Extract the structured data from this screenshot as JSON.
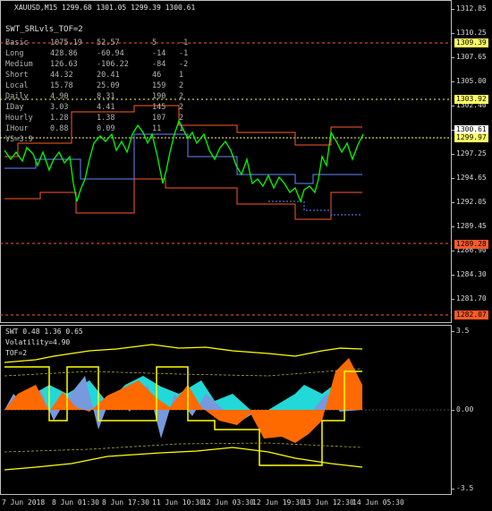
{
  "header": {
    "symbol": "XAUUSD,M15",
    "ohlc": "1299.68 1301.05 1299.39 1300.61",
    "indicator_title": "SWT_SRLvls_TOF=2"
  },
  "stats": {
    "rows": [
      {
        "label": "Basic",
        "c1": "1075.19",
        "c2": "52.57",
        "c3": "5",
        "c4": "-1"
      },
      {
        "label": "Long",
        "c1": "428.86",
        "c2": "-60.94",
        "c3": "-14",
        "c4": "-1"
      },
      {
        "label": "Medium",
        "c1": "126.63",
        "c2": "-106.22",
        "c3": "-84",
        "c4": "-2"
      },
      {
        "label": "Short",
        "c1": "44.32",
        "c2": "20.41",
        "c3": "46",
        "c4": "1"
      },
      {
        "label": "Local",
        "c1": "15.78",
        "c2": "25.09",
        "c3": "159",
        "c4": "2"
      },
      {
        "label": "Daily",
        "c1": "4.90",
        "c2": "8.31",
        "c3": "190",
        "c4": "2"
      },
      {
        "label": "IDay",
        "c1": "3.03",
        "c2": "4.41",
        "c3": "145",
        "c4": "2"
      },
      {
        "label": "Hourly",
        "c1": "1.28",
        "c2": "1.38",
        "c3": "107",
        "c4": "2"
      },
      {
        "label": "IHour",
        "c1": "0.88",
        "c2": "0.09",
        "c3": "11",
        "c4": "1"
      }
    ],
    "extra": "VS=3.9"
  },
  "price_axis": {
    "ticks": [
      "1312.85",
      "1310.25",
      "1307.65",
      "1305.00",
      "1302.40",
      "1299.80",
      "1297.25",
      "1294.65",
      "1292.05",
      "1289.45",
      "1286.90",
      "1284.30",
      "1281.70"
    ],
    "levels": [
      {
        "value": "1309.39",
        "color": "#ffff66"
      },
      {
        "value": "1303.92",
        "color": "#ffff66"
      },
      {
        "value": "1300.61",
        "color": "#ffffff"
      },
      {
        "value": "1299.97",
        "color": "#ffff66"
      },
      {
        "value": "1289.28",
        "color": "#ff5a28"
      },
      {
        "value": "1282.07",
        "color": "#ff5a28"
      }
    ]
  },
  "sub_window": {
    "title": "SWT 0.48 1.36 0.65",
    "volatility": "Volatility=4.90",
    "tof": "TOF=2",
    "axis_ticks": [
      "3.5",
      "0.00",
      "-3.5"
    ]
  },
  "time_axis": [
    "7 Jun 2018",
    "8 Jun 01:30",
    "8 Jun 17:30",
    "11 Jun 10:30",
    "12 Jun 03:30",
    "12 Jun 19:30",
    "13 Jun 12:30",
    "14 Jun 05:30"
  ],
  "colors": {
    "price": "#00ff00",
    "resistance": "#ff5a28",
    "support_blue": "#6688ff",
    "osc_orange": "#ff6a00",
    "osc_cyan": "#22d8d8",
    "osc_blue": "#7799dd",
    "osc_yellow": "#ffff00"
  }
}
